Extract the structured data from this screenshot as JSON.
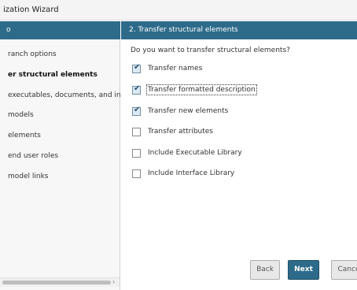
{
  "window": {
    "title": "ization Wizard"
  },
  "sidebar": {
    "header": "o",
    "items": [
      {
        "label": "ranch options"
      },
      {
        "label": "er structural elements",
        "active": true
      },
      {
        "label": "executables, documents, and int"
      },
      {
        "label": "models"
      },
      {
        "label": "elements"
      },
      {
        "label": "end user roles"
      },
      {
        "label": "model links"
      }
    ],
    "scroll_arrow": "›"
  },
  "main": {
    "header": "2. Transfer structural elements",
    "question": "Do you want to transfer structural elements?",
    "options": [
      {
        "label": "Transfer names",
        "checked": true
      },
      {
        "label": "Transfer formatted description",
        "checked": true,
        "focused": true
      },
      {
        "label": "Transfer new elements",
        "checked": true
      },
      {
        "label": "Transfer attributes",
        "checked": false
      },
      {
        "label": "Include Executable Library",
        "checked": false
      },
      {
        "label": "Include Interface Library",
        "checked": false
      }
    ]
  },
  "buttons": {
    "back": "Back",
    "next": "Next",
    "cancel": "Cance"
  },
  "colors": {
    "header_bg": "#2e6b8a",
    "primary_button": "#2e6b8a"
  },
  "icons": {
    "checkbox_tick": "✔"
  }
}
